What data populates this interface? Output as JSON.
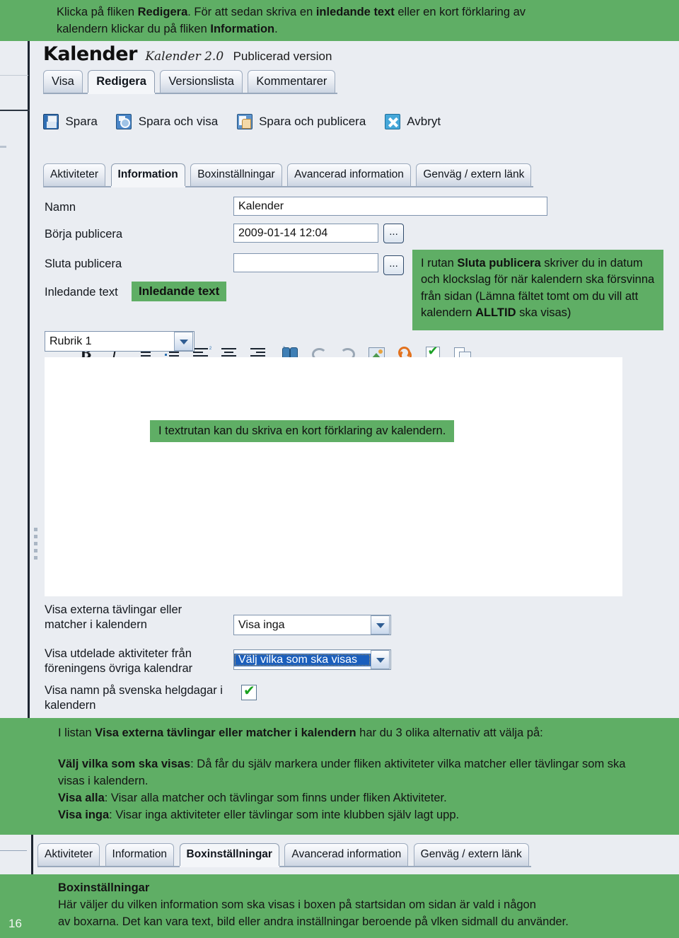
{
  "colors": {
    "green_accent": "#5FAE65",
    "app_background": "#EAEDF2",
    "editor_white": "#FFFFFF",
    "selection_blue": "#1B5FBD"
  },
  "annotations": {
    "top": {
      "line1_a": "Klicka på fliken ",
      "line1_b": "Redigera",
      "line1_c": ". För att sedan skriva en ",
      "line1_d": "inledande text",
      "line1_e": " eller en kort förklaring av",
      "line2_a": "kalendern klickar du på fliken ",
      "line2_b": "Information",
      "line2_c": "."
    },
    "sluta_publicera": {
      "a": "I rutan ",
      "b": "Sluta publicera",
      "c": " skriver du in datum och klockslag för när kalendern ska försvinna från sidan (Lämna fältet tomt om du vill att kalendern ",
      "d": "ALLTID",
      "e": " ska visas)"
    },
    "inledande_label": "Inledande text",
    "textrutan": "I textrutan kan du skriva en kort förklaring av kalendern.",
    "middle": {
      "p1_a": "I listan ",
      "p1_b": "Visa externa tävlingar eller matcher i kalendern",
      "p1_c": " har du 3 olika alternativ att välja på:",
      "p2_b": "Välj vilka som ska visas",
      "p2_c": ": Då får du själv markera under fliken aktiviteter vilka matcher eller tävlingar som ska visas i kalendern.",
      "p3_b": "Visa alla",
      "p3_c": ": Visar alla matcher och tävlingar som finns under fliken Aktiviteter.",
      "p4_b": "Visa inga",
      "p4_c": ": Visar inga aktiviteter eller tävlingar som inte klubben själv lagt upp."
    },
    "bottom": {
      "heading": "Boxinställningar",
      "line1": "Här väljer du vilken information som ska visas i boxen på startsidan om sidan är vald i någon",
      "line2": "av boxarna. Det kan vara text, bild eller andra inställningar beroende på vlken sidmall du använder."
    }
  },
  "page_number": "16",
  "app": {
    "title": {
      "name": "Kalender",
      "version": "Kalender 2.0",
      "state": "Publicerad version"
    },
    "main_tabs": [
      {
        "label": "Visa",
        "active": false
      },
      {
        "label": "Redigera",
        "active": true
      },
      {
        "label": "Versionslista",
        "active": false
      },
      {
        "label": "Kommentarer",
        "active": false
      }
    ],
    "commands": [
      {
        "label": "Spara",
        "icon": "floppy-disk-icon"
      },
      {
        "label": "Spara och visa",
        "icon": "floppy-preview-icon"
      },
      {
        "label": "Spara och publicera",
        "icon": "floppy-publish-icon"
      },
      {
        "label": "Avbryt",
        "icon": "cancel-x-icon"
      }
    ],
    "sub_tabs": [
      {
        "label": "Aktiviteter",
        "active": false
      },
      {
        "label": "Information",
        "active": true
      },
      {
        "label": "Boxinställningar",
        "active": false
      },
      {
        "label": "Avancerad information",
        "active": false
      },
      {
        "label": "Genväg / extern länk",
        "active": false
      }
    ],
    "bottom_tabs": [
      {
        "label": "Aktiviteter",
        "active": false
      },
      {
        "label": "Information",
        "active": false
      },
      {
        "label": "Boxinställningar",
        "active": true
      },
      {
        "label": "Avancerad information",
        "active": false
      },
      {
        "label": "Genväg / extern länk",
        "active": false
      }
    ],
    "fields": {
      "namn_label": "Namn",
      "namn_value": "Kalender",
      "borja_label": "Börja publicera",
      "borja_value": "2009-01-14 12:04",
      "sluta_label": "Sluta publicera",
      "sluta_value": "",
      "inledande_label": "Inledande text",
      "browse_button": "...",
      "style_select_value": "Rubrik 1"
    },
    "rte_buttons": [
      {
        "name": "bold-icon",
        "glyph": "B"
      },
      {
        "name": "italic-icon",
        "glyph": "I"
      },
      {
        "name": "ordered-list-icon",
        "glyph": ""
      },
      {
        "name": "unordered-list-icon",
        "glyph": ""
      },
      {
        "name": "align-left-icon",
        "glyph": ""
      },
      {
        "name": "align-center-icon",
        "glyph": ""
      },
      {
        "name": "align-right-icon",
        "glyph": ""
      },
      {
        "name": "find-binoculars-icon",
        "glyph": ""
      },
      {
        "name": "undo-icon",
        "glyph": ""
      },
      {
        "name": "redo-icon",
        "glyph": ""
      },
      {
        "name": "insert-image-icon",
        "glyph": ""
      },
      {
        "name": "insert-link-icon",
        "glyph": ""
      },
      {
        "name": "spellcheck-icon",
        "glyph": ""
      },
      {
        "name": "copy-paste-icon",
        "glyph": ""
      }
    ],
    "settings": {
      "row1_label_l1": "Visa externa tävlingar eller",
      "row1_label_l2": "matcher i kalendern",
      "row1_value": "Visa inga",
      "row2_label_l1": "Visa utdelade aktiviteter från",
      "row2_label_l2": "föreningens övriga kalendrar",
      "row2_value": "Välj vilka som ska visas",
      "row3_label_l1": "Visa namn på svenska helgdagar i",
      "row3_label_l2": "kalendern",
      "row3_checked": true
    }
  }
}
